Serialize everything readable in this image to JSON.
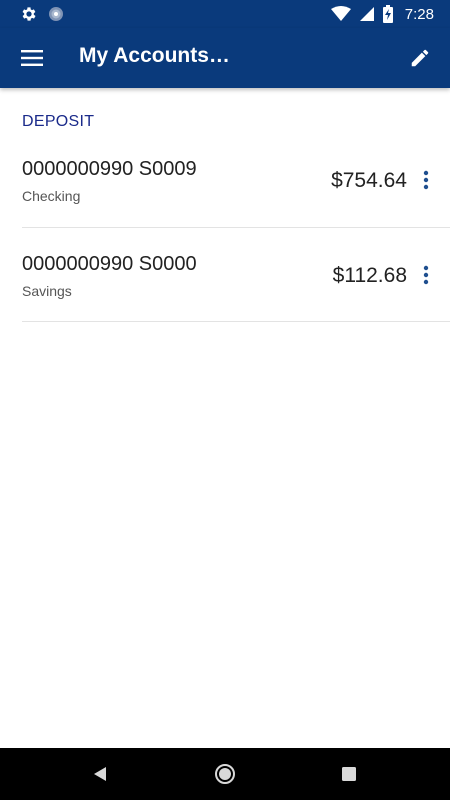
{
  "status_bar": {
    "time": "7:28",
    "icons": [
      "settings-icon",
      "sync-icon",
      "wifi-icon",
      "signal-icon",
      "battery-charging-icon"
    ]
  },
  "app_bar": {
    "title": "My Accounts…",
    "menu_icon": "menu-icon",
    "edit_icon": "edit-pencil-icon"
  },
  "section": {
    "header": "DEPOSIT"
  },
  "accounts": [
    {
      "number": "0000000990 S0009",
      "type": "Checking",
      "balance": "$754.64"
    },
    {
      "number": "0000000990 S0000",
      "type": "Savings",
      "balance": "$112.68"
    }
  ],
  "nav_bar": {
    "icons": [
      "back-icon",
      "home-icon",
      "recents-icon"
    ]
  },
  "colors": {
    "primary": "#0a3a7c",
    "section_header": "#1a2a8a",
    "overflow_icon": "#1f4f8f"
  }
}
